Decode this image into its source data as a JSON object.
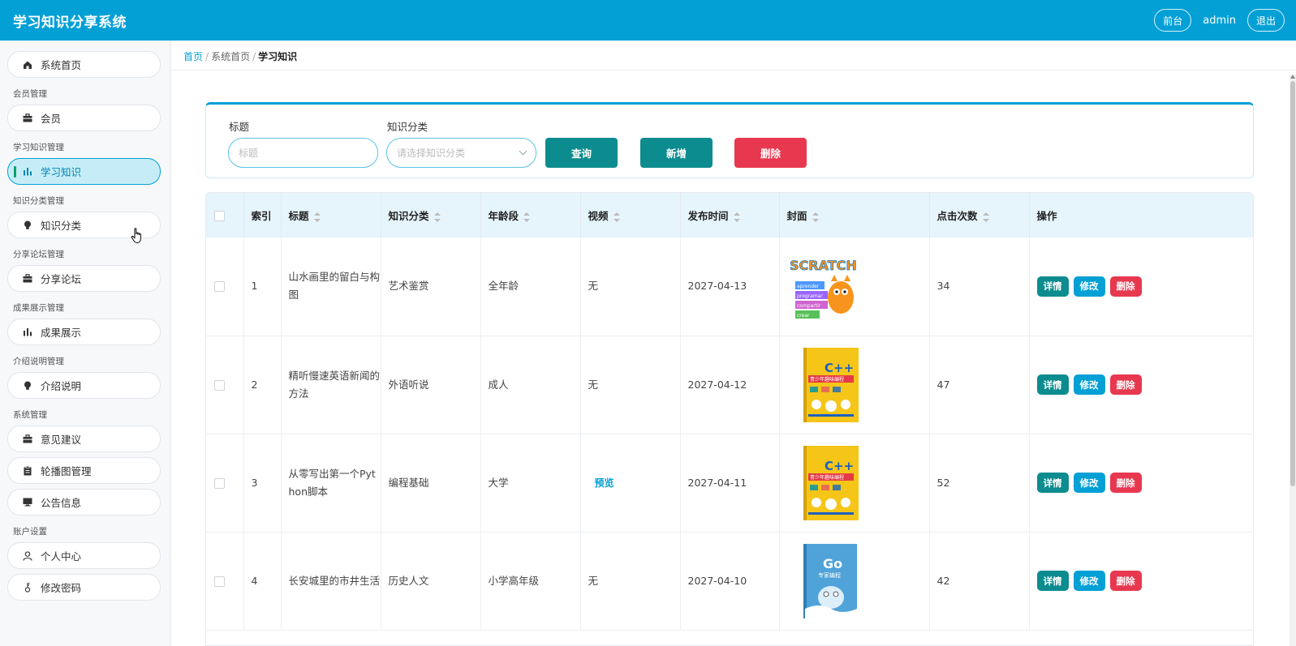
{
  "app": {
    "title": "学习知识分享系统"
  },
  "header": {
    "front_label": "前台",
    "user": "admin",
    "logout_label": "退出"
  },
  "sidebar": {
    "home": "系统首页",
    "groups": [
      {
        "title": "会员管理",
        "items": [
          {
            "label": "会员",
            "icon": "briefcase-icon"
          }
        ]
      },
      {
        "title": "学习知识管理",
        "items": [
          {
            "label": "学习知识",
            "icon": "bar-chart-icon",
            "active": true
          }
        ]
      },
      {
        "title": "知识分类管理",
        "items": [
          {
            "label": "知识分类",
            "icon": "bulb-icon"
          }
        ]
      },
      {
        "title": "分享论坛管理",
        "items": [
          {
            "label": "分享论坛",
            "icon": "briefcase-icon"
          }
        ]
      },
      {
        "title": "成果展示管理",
        "items": [
          {
            "label": "成果展示",
            "icon": "bar-chart-icon"
          }
        ]
      },
      {
        "title": "介绍说明管理",
        "items": [
          {
            "label": "介绍说明",
            "icon": "bulb-icon"
          }
        ]
      },
      {
        "title": "系统管理",
        "items": [
          {
            "label": "意见建议",
            "icon": "briefcase-icon"
          },
          {
            "label": "轮播图管理",
            "icon": "clipboard-icon"
          },
          {
            "label": "公告信息",
            "icon": "monitor-icon"
          }
        ]
      },
      {
        "title": "账户设置",
        "items": [
          {
            "label": "个人中心",
            "icon": "user-icon"
          },
          {
            "label": "修改密码",
            "icon": "key-icon"
          }
        ]
      }
    ]
  },
  "breadcrumb": {
    "items": [
      "首页",
      "系统首页",
      "学习知识"
    ],
    "sep": "/"
  },
  "search": {
    "title_label": "标题",
    "title_placeholder": "标题",
    "category_label": "知识分类",
    "category_placeholder": "请选择知识分类",
    "query_btn": "查询",
    "add_btn": "新增",
    "delete_btn": "删除"
  },
  "table": {
    "columns": [
      "索引",
      "标题",
      "知识分类",
      "年龄段",
      "视频",
      "发布时间",
      "封面",
      "点击次数",
      "操作"
    ],
    "rows": [
      {
        "index": "1",
        "title": "山水画里的留白与构图",
        "category": "艺术鉴赏",
        "age": "全年龄",
        "video": "无",
        "date": "2027-04-13",
        "cover": "scratch-cover",
        "clicks": "34"
      },
      {
        "index": "2",
        "title": "精听慢速英语新闻的方法",
        "category": "外语听说",
        "age": "成人",
        "video": "无",
        "date": "2027-04-12",
        "cover": "cpp-book-cover",
        "clicks": "47"
      },
      {
        "index": "3",
        "title": "从零写出第一个Python脚本",
        "category": "编程基础",
        "age": "大学",
        "video": "预览",
        "date": "2027-04-11",
        "cover": "cpp-book-cover",
        "clicks": "52"
      },
      {
        "index": "4",
        "title": "长安城里的市井生活",
        "category": "历史人文",
        "age": "小学高年级",
        "video": "无",
        "date": "2027-04-10",
        "cover": "go-book-cover",
        "clicks": "42"
      }
    ],
    "ops": {
      "detail": "详情",
      "edit": "修改",
      "delete": "删除"
    }
  },
  "cover_text": {
    "scratch_word": "SCRATCH",
    "scratch_lines": [
      "aprender",
      "programar",
      "compartir",
      "crear"
    ],
    "cpp": "C++",
    "cpp_sub": "青少年趣味编程",
    "go": "Go",
    "go_sub": "专家编程"
  }
}
